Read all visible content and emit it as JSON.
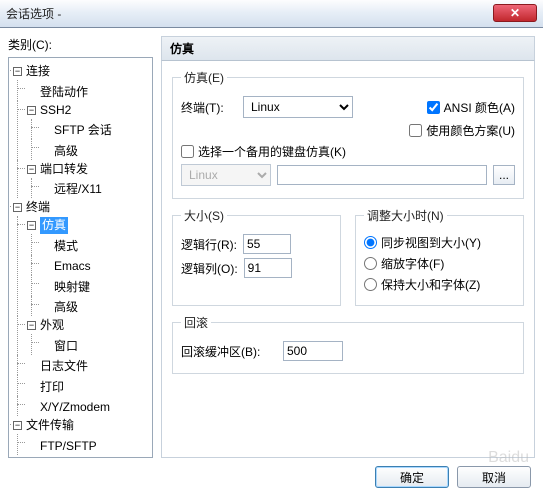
{
  "window": {
    "title": "会话选项 -",
    "close": "✕"
  },
  "left": {
    "category_label": "类别(C):",
    "tree": {
      "connection": "连接",
      "login_actions": "登陆动作",
      "ssh2": "SSH2",
      "sftp": "SFTP 会话",
      "advanced": "高级",
      "port_forward": "端口转发",
      "remote_x11": "远程/X11",
      "terminal": "终端",
      "emulation": "仿真",
      "modes": "模式",
      "emacs": "Emacs",
      "mapped_keys": "映射键",
      "advanced2": "高级",
      "appearance": "外观",
      "window": "窗口",
      "log_file": "日志文件",
      "printing": "打印",
      "xyzmodem": "X/Y/Zmodem",
      "file_transfer": "文件传输",
      "ftp_sftp": "FTP/SFTP"
    }
  },
  "panel": {
    "title": "仿真",
    "emu_group": "仿真(E)",
    "terminal_label": "终端(T):",
    "terminal_value": "Linux",
    "ansi_color": "ANSI 颜色(A)",
    "use_scheme": "使用颜色方案(U)",
    "alt_kb": "选择一个备用的键盘仿真(K)",
    "alt_kb_value": "Linux",
    "browse": "...",
    "size_group": "大小(S)",
    "rows_label": "逻辑行(R):",
    "rows_value": "55",
    "cols_label": "逻辑列(O):",
    "cols_value": "91",
    "resize_group": "调整大小时(N)",
    "r1": "同步视图到大小(Y)",
    "r2": "缩放字体(F)",
    "r3": "保持大小和字体(Z)",
    "scroll_group": "回滚",
    "scroll_label": "回滚缓冲区(B):",
    "scroll_value": "500"
  },
  "buttons": {
    "ok": "确定",
    "cancel": "取消"
  },
  "watermark": "Baidu"
}
